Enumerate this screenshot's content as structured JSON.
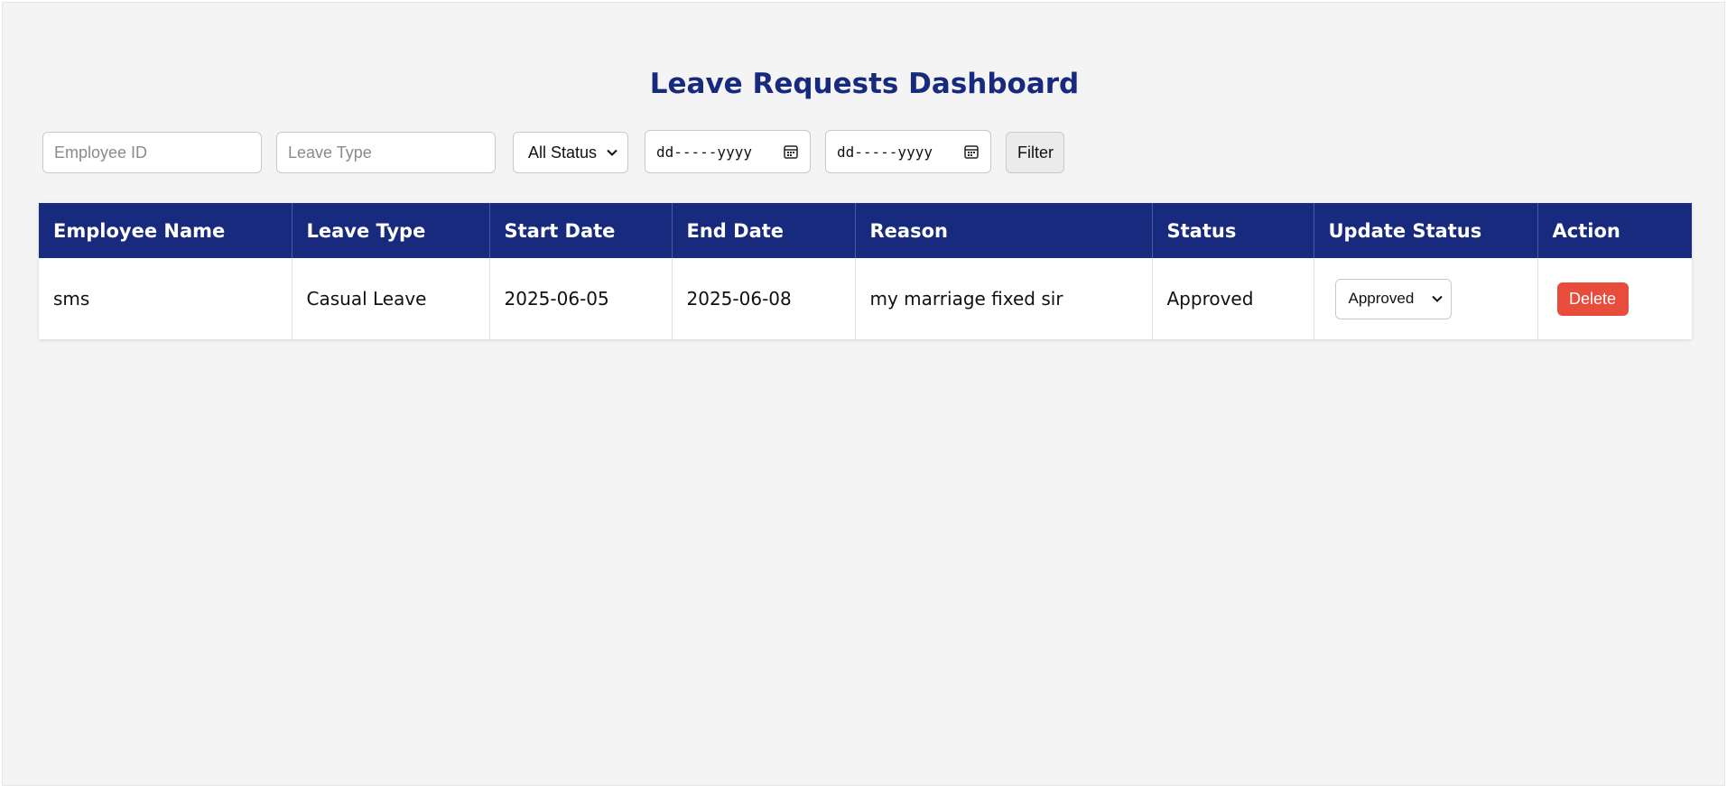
{
  "page": {
    "title": "Leave Requests Dashboard"
  },
  "filters": {
    "employee_id_placeholder": "Employee ID",
    "leave_type_placeholder": "Leave Type",
    "status_selected": "All Status",
    "start_date_placeholder": "dd-----yyyy",
    "end_date_placeholder": "dd-----yyyy",
    "filter_label": "Filter"
  },
  "table": {
    "headers": [
      "Employee Name",
      "Leave Type",
      "Start Date",
      "End Date",
      "Reason",
      "Status",
      "Update Status",
      "Action"
    ],
    "rows": [
      {
        "employee_name": "sms",
        "leave_type": "Casual Leave",
        "start_date": "2025-06-05",
        "end_date": "2025-06-08",
        "reason": "my marriage fixed sir",
        "status": "Approved",
        "update_status": "Approved",
        "action_label": "Delete"
      }
    ]
  },
  "icons": {
    "select_chevron": "chevron-down-icon",
    "date_picker": "calendar-icon"
  },
  "colors": {
    "primary": "#172a7e",
    "danger": "#e74c3c",
    "background": "#f4f4f4"
  }
}
